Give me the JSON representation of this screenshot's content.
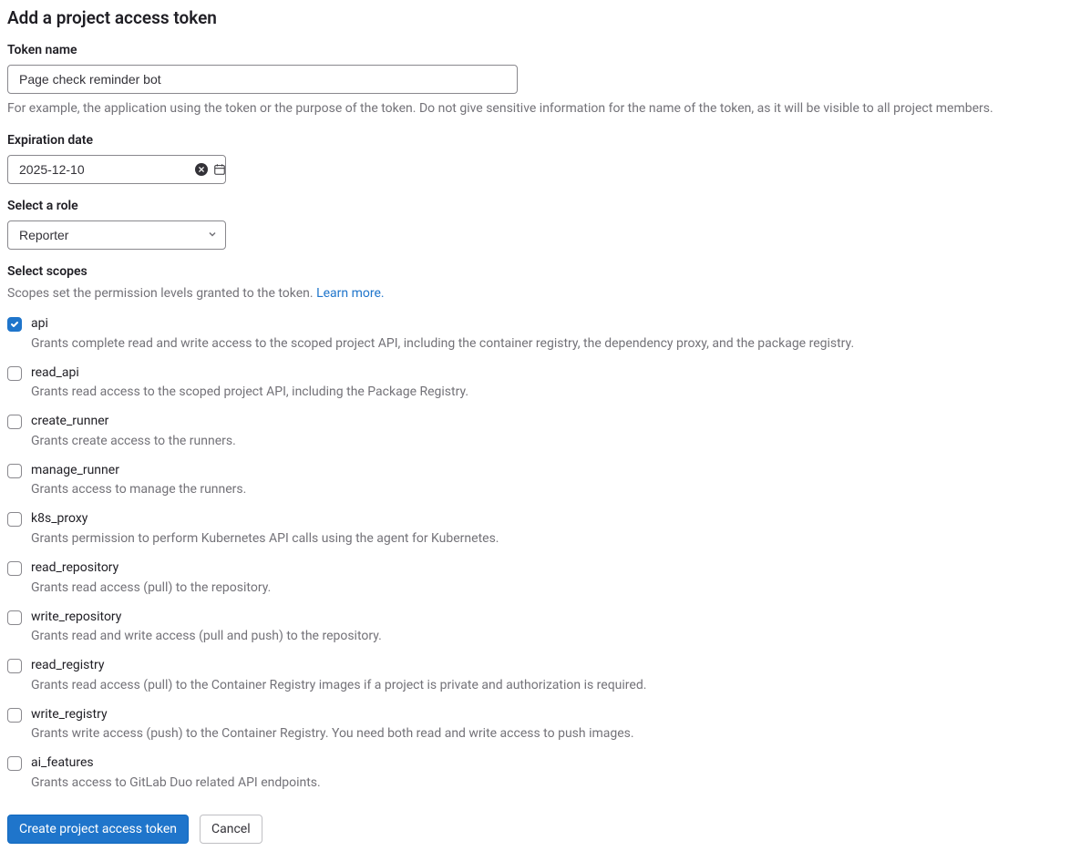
{
  "heading": "Add a project access token",
  "token_name": {
    "label": "Token name",
    "value": "Page check reminder bot",
    "help": "For example, the application using the token or the purpose of the token. Do not give sensitive information for the name of the token, as it will be visible to all project members."
  },
  "expiration": {
    "label": "Expiration date",
    "value": "2025-12-10"
  },
  "role": {
    "label": "Select a role",
    "value": "Reporter"
  },
  "scopes": {
    "label": "Select scopes",
    "help_prefix": "Scopes set the permission levels granted to the token. ",
    "learn_more": "Learn more.",
    "items": [
      {
        "name": "api",
        "desc": "Grants complete read and write access to the scoped project API, including the container registry, the dependency proxy, and the package registry.",
        "checked": true
      },
      {
        "name": "read_api",
        "desc": "Grants read access to the scoped project API, including the Package Registry.",
        "checked": false
      },
      {
        "name": "create_runner",
        "desc": "Grants create access to the runners.",
        "checked": false
      },
      {
        "name": "manage_runner",
        "desc": "Grants access to manage the runners.",
        "checked": false
      },
      {
        "name": "k8s_proxy",
        "desc": "Grants permission to perform Kubernetes API calls using the agent for Kubernetes.",
        "checked": false
      },
      {
        "name": "read_repository",
        "desc": "Grants read access (pull) to the repository.",
        "checked": false
      },
      {
        "name": "write_repository",
        "desc": "Grants read and write access (pull and push) to the repository.",
        "checked": false
      },
      {
        "name": "read_registry",
        "desc": "Grants read access (pull) to the Container Registry images if a project is private and authorization is required.",
        "checked": false
      },
      {
        "name": "write_registry",
        "desc": "Grants write access (push) to the Container Registry. You need both read and write access to push images.",
        "checked": false
      },
      {
        "name": "ai_features",
        "desc": "Grants access to GitLab Duo related API endpoints.",
        "checked": false
      }
    ]
  },
  "buttons": {
    "create": "Create project access token",
    "cancel": "Cancel"
  }
}
